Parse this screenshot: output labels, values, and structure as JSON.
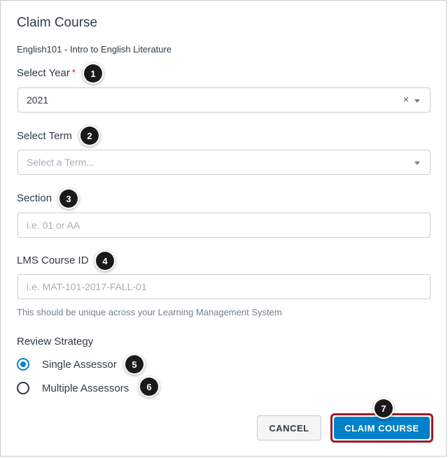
{
  "dialog": {
    "title": "Claim Course",
    "course_name": "English101 - Intro to English Literature"
  },
  "year": {
    "label": "Select Year",
    "required_mark": "*",
    "value": "2021",
    "clear_glyph": "×"
  },
  "term": {
    "label": "Select Term",
    "placeholder": "Select a Term..."
  },
  "section": {
    "label": "Section",
    "placeholder": "i.e. 01 or AA"
  },
  "lms_course_id": {
    "label": "LMS Course ID",
    "placeholder": "i.e. MAT-101-2017-FALL-01",
    "hint": "This should be unique across your Learning Management System"
  },
  "review_strategy": {
    "label": "Review Strategy",
    "options": [
      {
        "label": "Single Assessor",
        "selected": true
      },
      {
        "label": "Multiple Assessors",
        "selected": false
      }
    ]
  },
  "buttons": {
    "cancel": "CANCEL",
    "claim": "CLAIM COURSE"
  },
  "callouts": [
    "1",
    "2",
    "3",
    "4",
    "5",
    "6",
    "7"
  ],
  "colors": {
    "accent": "#0081c8",
    "required": "#e0061f",
    "highlight_border": "#9e1b2a",
    "text": "#2d3b45",
    "hint": "#73818c"
  }
}
